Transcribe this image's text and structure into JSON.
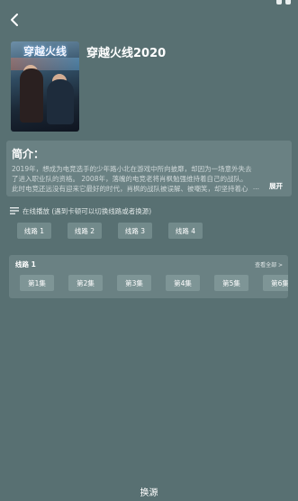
{
  "app": {
    "title": "穿越火线2020",
    "poster_text": "穿越火线"
  },
  "icons": {
    "back": "chevron-left-icon",
    "playlist": "playlist-icon"
  },
  "synopsis": {
    "heading": "简介：",
    "text": "2019年，想成为电竞选手的少年路小北在游戏中所向披靡，却因为一场意外失去了进入职业队的资格。 2008年，落魄的电竞老将肖枫勉强维持着自己的战队。此时电竞还远没有迎来它最好的时代，肖枫的战队被误解、被嘲笑，却坚持着心中的梦想。",
    "ellipsis": "...",
    "expand_label": "展开"
  },
  "online": {
    "label": "在线播放 (遇到卡顿可以切换线路或者换源)"
  },
  "lines": [
    "线路 1",
    "线路 2",
    "线路 3",
    "线路 4"
  ],
  "episodes": {
    "title": "线路 1",
    "view_all": "查看全部 >",
    "items": [
      "第1集",
      "第2集",
      "第3集",
      "第4集",
      "第5集",
      "第6集"
    ]
  },
  "footer": {
    "switch_source": "换源"
  },
  "colors": {
    "background": "#587072",
    "card": "#6a8183",
    "button": "#728a8b"
  }
}
